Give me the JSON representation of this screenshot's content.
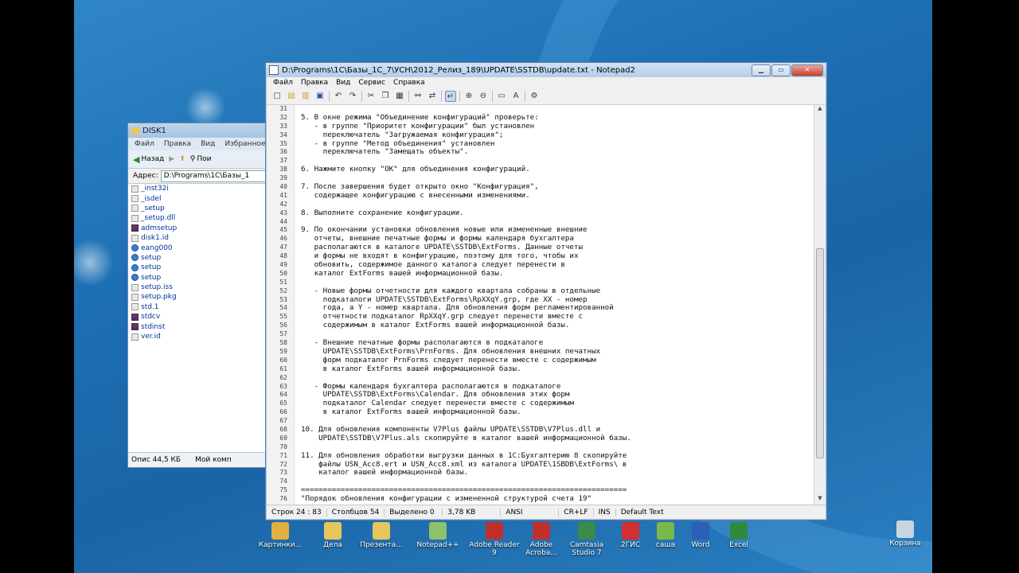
{
  "explorer": {
    "title": "DISK1",
    "menu": [
      "Файл",
      "Правка",
      "Вид",
      "Избранное"
    ],
    "back_label": "Назад",
    "search_label": "Пои",
    "address_label": "Адрес:",
    "address_value": "D:\\Programs\\1C\\Базы_1",
    "files": [
      {
        "name": "_inst32i",
        "type": "file"
      },
      {
        "name": "_isdel",
        "type": "file"
      },
      {
        "name": "_setup",
        "type": "file"
      },
      {
        "name": "_setup.dll",
        "type": "file"
      },
      {
        "name": "admsetup",
        "type": "rar"
      },
      {
        "name": "disk1.id",
        "type": "file"
      },
      {
        "name": "eang000",
        "type": "set"
      },
      {
        "name": "setup",
        "type": "set"
      },
      {
        "name": "setup",
        "type": "set"
      },
      {
        "name": "setup",
        "type": "set"
      },
      {
        "name": "setup.iss",
        "type": "file"
      },
      {
        "name": "setup.pkg",
        "type": "file"
      },
      {
        "name": "std.1",
        "type": "file"
      },
      {
        "name": "stdcv",
        "type": "rar"
      },
      {
        "name": "stdinst",
        "type": "rar"
      },
      {
        "name": "ver.id",
        "type": "file"
      }
    ],
    "status_left": "Опис  44,5 КБ",
    "status_right": "Мой комп"
  },
  "notepad": {
    "title": "D:\\Programs\\1C\\Базы_1С_7\\УСН\\2012_Релиз_189\\UPDATE\\SSTDB\\update.txt - Notepad2",
    "menu": [
      "Файл",
      "Правка",
      "Вид",
      "Сервис",
      "Справка"
    ],
    "line_numbers": [
      "31",
      "32",
      "33",
      "34",
      "35",
      "36",
      "37",
      "38",
      "39",
      "40",
      "41",
      "42",
      "43",
      "44",
      "45",
      "46",
      "47",
      "48",
      "49",
      "50",
      "51",
      "52",
      "53",
      "54",
      "55",
      "56",
      "57",
      "58",
      "59",
      "60",
      "61",
      "62",
      "63",
      "64",
      "65",
      "66",
      "67",
      "68",
      "69",
      "70",
      "71",
      "72",
      "73",
      "74",
      "75",
      "76"
    ],
    "lines": [
      "",
      "5. В окне режима \"Объединение конфигураций\" проверьте:",
      "   - в группе \"Приоритет конфигурации\" был установлен",
      "     переключатель \"Загружаемая конфигурация\";",
      "   - в группе \"Метод объединения\" установлен",
      "     переключатель \"Замещать объекты\".",
      "",
      "6. Нажмите кнопку \"ОК\" для объединения конфигураций.",
      "",
      "7. После завершения будет открыто окно \"Конфигурация\",",
      "   содержащее конфигурацию с внесенными изменениями.",
      "",
      "8. Выполните сохранение конфигурации.",
      "",
      "9. По окончании установки обновления новые или измененные внешние",
      "   отчеты, внешние печатные формы и формы календаря бухгалтера",
      "   располагаются в каталоге UPDATE\\SSTDB\\ExtForms. Данные отчеты",
      "   и формы не входят в конфигурацию, поэтому для того, чтобы их",
      "   обновить, содержимое данного каталога следует перенести в",
      "   каталог ExtForms вашей информационной базы.",
      "",
      "   - Новые формы отчетности для каждого квартала собраны в отдельные",
      "     подкаталоги UPDATE\\SSTDB\\ExtForms\\RpXXqY.grp, где XX - номер",
      "     года, а Y - номер квартала. Для обновления форм регламентированной",
      "     отчетности подкаталог RpXXqY.grp следует перенести вместе с",
      "     содержимым в каталог ExtForms вашей информационной базы.",
      "",
      "   - Внешние печатные формы располагаются в подкаталоге",
      "     UPDATE\\SSTDB\\ExtForms\\PrnForms. Для обновления внешних печатных",
      "     форм подкаталог PrnForms следует перенести вместе с содержимым",
      "     в каталог ExtForms вашей информационной базы.",
      "",
      "   - Формы календаря бухгалтера располагаются в подкаталоге",
      "     UPDATE\\SSTDB\\ExtForms\\Calendar. Для обновления этих форм",
      "     подкаталог Calendar следует перенести вместе с содержимым",
      "     в каталог ExtForms вашей информационной базы.",
      "",
      "10. Для обновления компоненты V7Plus файлы UPDATE\\SSTDB\\V7Plus.dll и",
      "    UPDATE\\SSTDB\\V7Plus.als скопируйте в каталог вашей информационной базы.",
      "",
      "11. Для обновления обработки выгрузки данных в 1С:Бухгалтерию 8 скопируйте",
      "    файлы USN_Acc8.ert и USN_Acc8.xml из каталога UPDATE\\1SBDB\\ExtForms\\ в",
      "    каталог вашей информационной базы.",
      "",
      "==========================================================================",
      "\"Порядок обновления конфигурации с измененной структурой счета 19\""
    ],
    "status": {
      "pos": "Строк 24 : 83",
      "col": "Столбцов 54",
      "sel": "Выделено 0",
      "size": "3,78 KB",
      "enc": "ANSI",
      "eol": "CR+LF",
      "ins": "INS",
      "scheme": "Default Text"
    }
  },
  "desktop_icons": [
    {
      "label": "Картинки...",
      "color": "#e0b040"
    },
    {
      "label": "Дела",
      "color": "#e6c65a"
    },
    {
      "label": "Презента...",
      "color": "#e6c65a"
    },
    {
      "label": "Notepad++",
      "color": "#8fc06a"
    },
    {
      "label": "Adobe Reader 9",
      "color": "#c0302a"
    },
    {
      "label": "Adobe Acroba...",
      "color": "#c0302a"
    },
    {
      "label": "Camtasia Studio 7",
      "color": "#3a8a4a"
    },
    {
      "label": "2ГИС",
      "color": "#d03030"
    },
    {
      "label": "саша",
      "color": "#7ab848"
    },
    {
      "label": "Word",
      "color": "#2b5fb8"
    },
    {
      "label": "Excel",
      "color": "#2e8a3e"
    },
    {
      "label": "Корзина",
      "color": "#c8d4e0"
    }
  ]
}
